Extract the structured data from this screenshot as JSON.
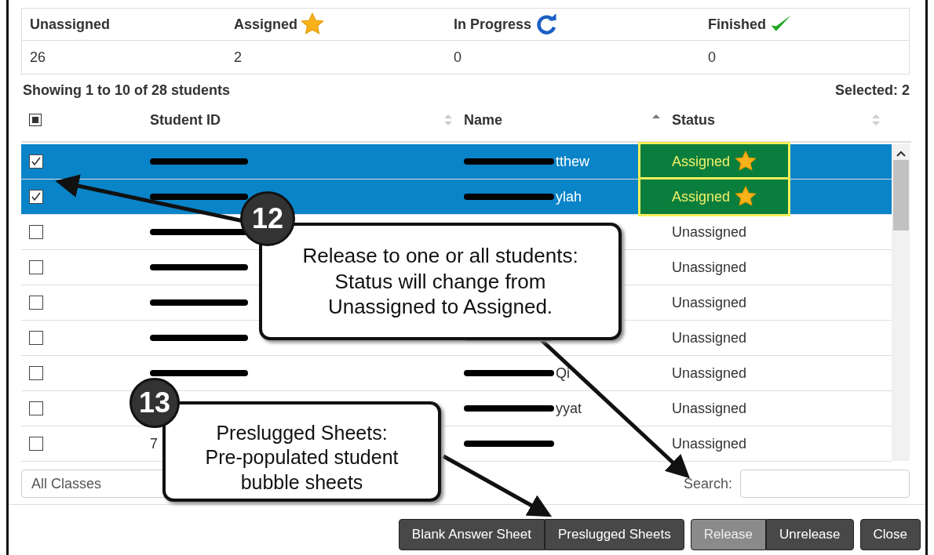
{
  "summary": {
    "columns": [
      {
        "label": "Unassigned",
        "value": "26"
      },
      {
        "label": "Assigned",
        "value": "2"
      },
      {
        "label": "In Progress",
        "value": "0"
      },
      {
        "label": "Finished",
        "value": "0"
      }
    ]
  },
  "showing": "Showing 1 to 10 of 28 students",
  "selected_count": "Selected: 2",
  "table": {
    "header_checkbox_partial": true,
    "columns": [
      {
        "label": "Student ID",
        "sorted": false
      },
      {
        "label": "Name",
        "sorted": true
      },
      {
        "label": "Status",
        "sorted": false
      }
    ],
    "rows": [
      {
        "checked": true,
        "highlighted": true,
        "name_visible": "tthew",
        "status": "Assigned",
        "kind": "assigned"
      },
      {
        "checked": true,
        "highlighted": true,
        "name_visible": "ylah",
        "status": "Assigned",
        "kind": "assigned"
      },
      {
        "checked": false,
        "highlighted": false,
        "status": "Unassigned",
        "kind": "unassigned"
      },
      {
        "checked": false,
        "highlighted": false,
        "status": "Unassigned",
        "kind": "unassigned"
      },
      {
        "checked": false,
        "highlighted": false,
        "status": "Unassigned",
        "kind": "unassigned"
      },
      {
        "checked": false,
        "highlighted": false,
        "status": "Unassigned",
        "kind": "unassigned"
      },
      {
        "checked": false,
        "highlighted": false,
        "name_visible": "Qi",
        "status": "Unassigned",
        "kind": "unassigned"
      },
      {
        "checked": false,
        "highlighted": false,
        "name_visible": "yyat",
        "status": "Unassigned",
        "kind": "unassigned"
      },
      {
        "checked": false,
        "highlighted": false,
        "id_visible": "7",
        "status": "Unassigned",
        "kind": "unassigned"
      }
    ]
  },
  "class_filter": {
    "value": "All Classes"
  },
  "search": {
    "label": "Search:"
  },
  "button_groups": [
    [
      {
        "label": "Blank Answer Sheet",
        "highlighted": false
      },
      {
        "label": "Preslugged Sheets",
        "highlighted": false
      }
    ],
    [
      {
        "label": "Release",
        "highlighted": true
      },
      {
        "label": "Unrelease",
        "highlighted": false
      }
    ],
    [
      {
        "label": "Close",
        "highlighted": false
      }
    ]
  ],
  "callouts": [
    {
      "number": "12",
      "text": "Release to one or all students: Status will change from Unassigned to Assigned."
    },
    {
      "number": "13",
      "text": "Preslugged Sheets: Pre-populated student bubble sheets"
    }
  ]
}
